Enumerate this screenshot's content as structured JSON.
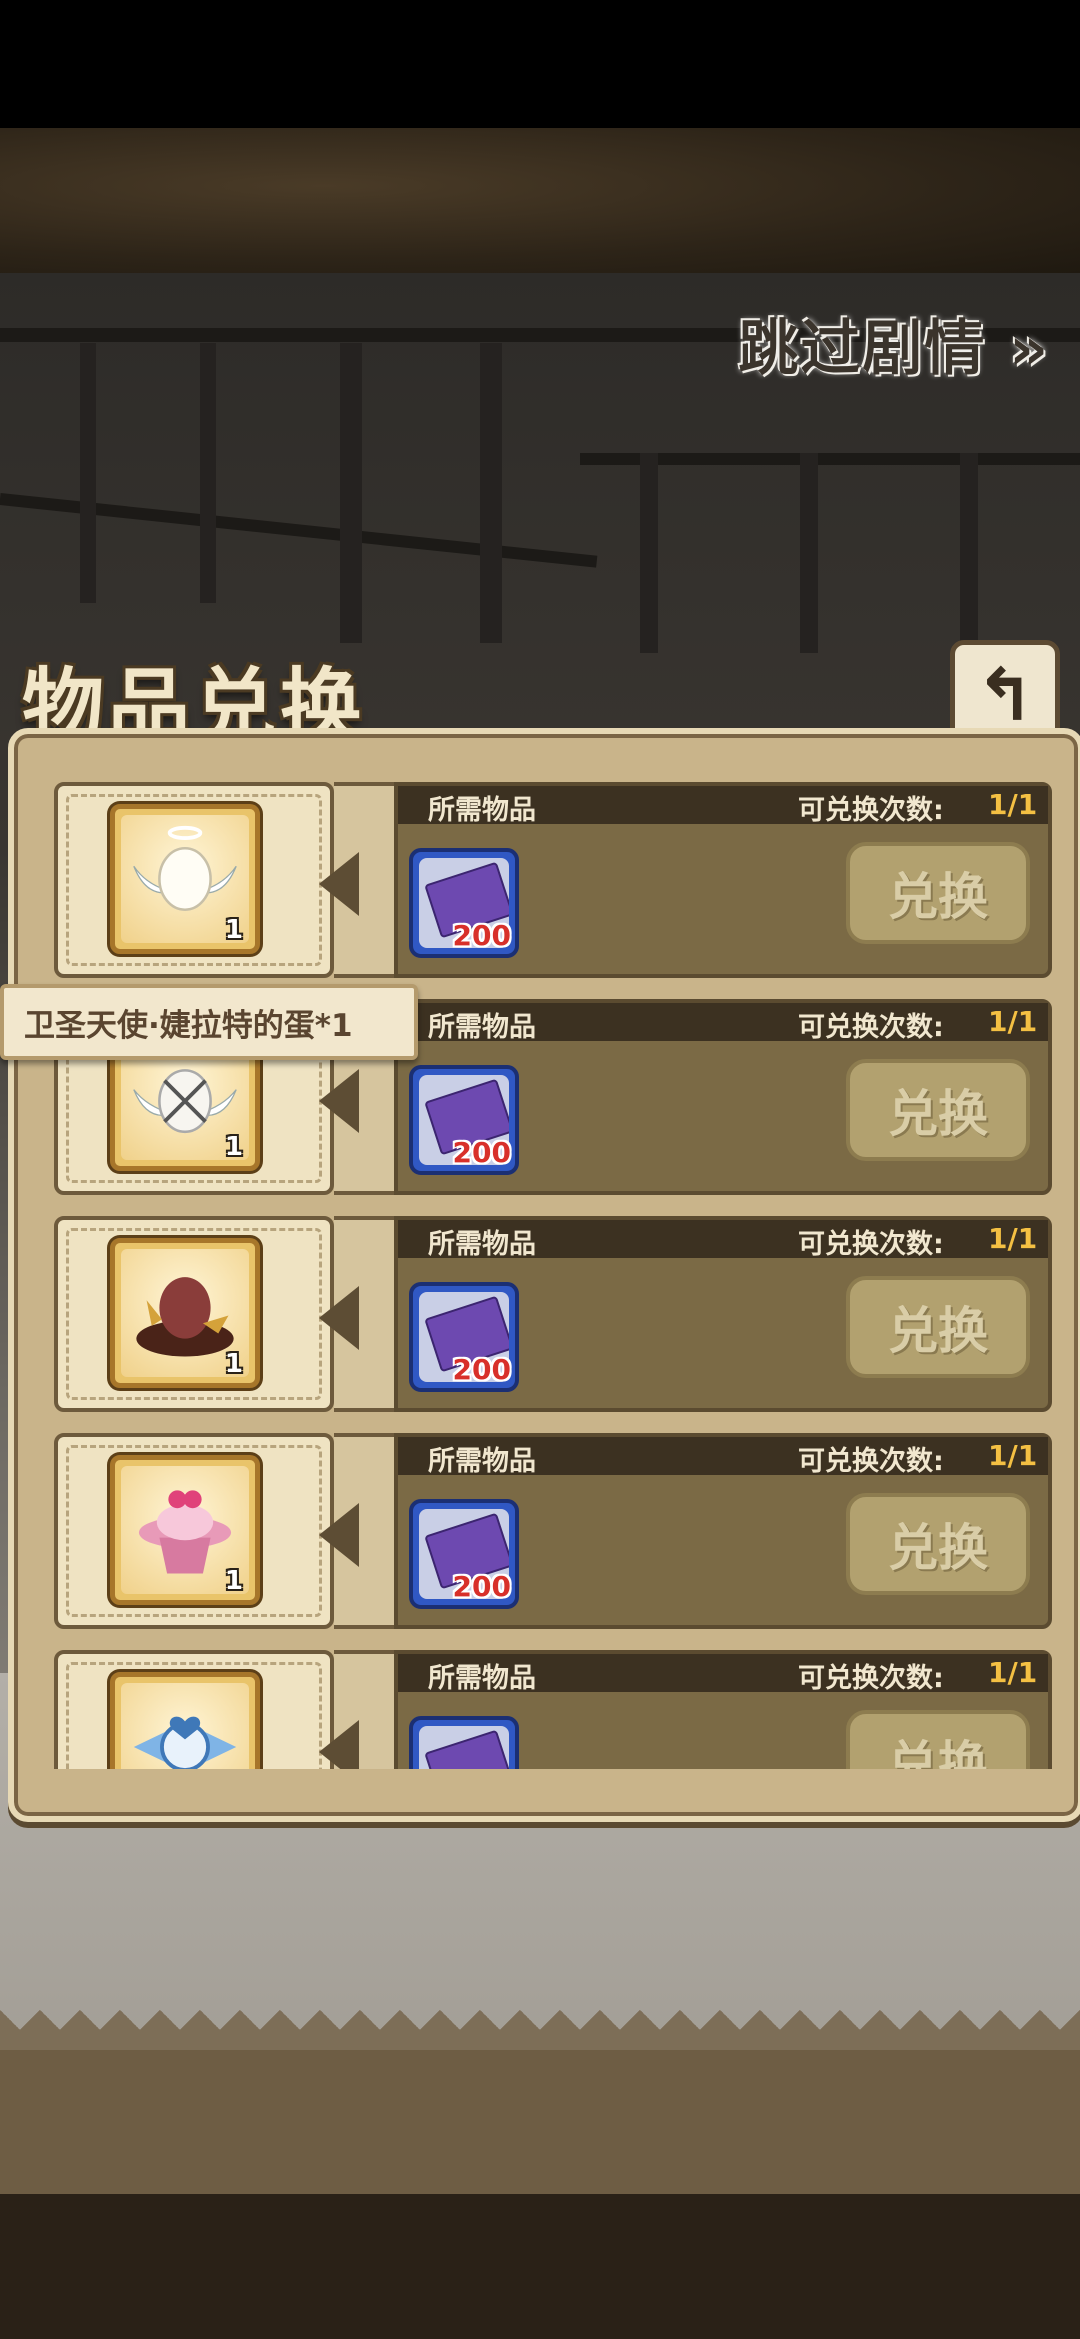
{
  "header": {
    "skip_label": "跳过剧情 »",
    "title": "物品兑换",
    "back_icon": "↰"
  },
  "tooltip": {
    "text": "卫圣天使·婕拉特的蛋*1"
  },
  "rows": [
    {
      "req_label": "所需物品",
      "count_label": "可兑换次数:",
      "count_value": "1/1",
      "item_name": "angel-egg-icon",
      "item_qty": "1",
      "cost": "200",
      "button": "兑换"
    },
    {
      "req_label": "所需物品",
      "count_label": "可兑换次数:",
      "count_value": "1/1",
      "item_name": "wrapped-egg-icon",
      "item_qty": "1",
      "cost": "200",
      "button": "兑换"
    },
    {
      "req_label": "所需物品",
      "count_label": "可兑换次数:",
      "count_value": "1/1",
      "item_name": "dark-egg-icon",
      "item_qty": "1",
      "cost": "200",
      "button": "兑换"
    },
    {
      "req_label": "所需物品",
      "count_label": "可兑换次数:",
      "count_value": "1/1",
      "item_name": "cupcake-icon",
      "item_qty": "1",
      "cost": "200",
      "button": "兑换"
    },
    {
      "req_label": "所需物品",
      "count_label": "可兑换次数:",
      "count_value": "1/1",
      "item_name": "heart-bow-icon",
      "item_qty": "",
      "cost": "",
      "button": "兑换"
    }
  ]
}
